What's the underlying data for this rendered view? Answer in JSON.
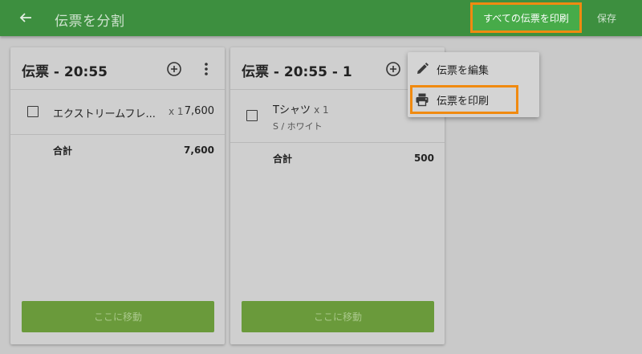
{
  "header": {
    "title": "伝票を分割",
    "print_all_label": "すべての伝票を印刷",
    "save_label": "保存"
  },
  "tickets": [
    {
      "title": "伝票 - 20:55",
      "items": [
        {
          "name": "エクストリームフレ...",
          "qty": "x 1",
          "price": "7,600",
          "variant": ""
        }
      ],
      "total_label": "合計",
      "total_value": "7,600",
      "move_label": "ここに移動"
    },
    {
      "title": "伝票 - 20:55 - 1",
      "items": [
        {
          "name": "Tシャツ",
          "qty": "x 1",
          "price": "",
          "variant": "S / ホワイト"
        }
      ],
      "total_label": "合計",
      "total_value": "500",
      "move_label": "ここに移動"
    }
  ],
  "menu": {
    "edit_label": "伝票を編集",
    "print_label": "伝票を印刷"
  },
  "colors": {
    "appbar": "#3d8f3f",
    "highlight": "#f08a10",
    "move_button": "#6a9a3b"
  },
  "icons": [
    "back-arrow-icon",
    "add-circle-icon",
    "more-vert-icon",
    "pencil-icon",
    "printer-icon"
  ]
}
